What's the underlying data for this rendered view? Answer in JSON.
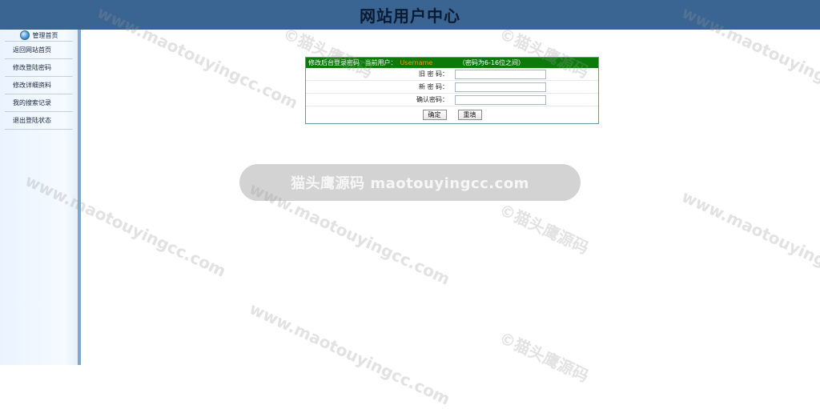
{
  "header": {
    "title": "网站用户中心"
  },
  "sidebar": {
    "heading": "管理首页",
    "items": [
      {
        "label": "返回网站首页"
      },
      {
        "label": "修改登陆密码"
      },
      {
        "label": "修改详细资料"
      },
      {
        "label": "我的搜索记录"
      },
      {
        "label": "退出登陆状态"
      }
    ]
  },
  "panel": {
    "title": "修改后台登录密码",
    "current_user_label": "当前用户：",
    "current_user": "Username",
    "hint": "（密码为6-16位之间）",
    "fields": {
      "old_password_label": "旧 密 码：",
      "new_password_label": "新 密 码：",
      "confirm_password_label": "确认密码："
    },
    "submit_label": "确定",
    "reset_label": "重填"
  },
  "watermark": {
    "bar_text": "猫头鹰源码 maotouyingcc.com",
    "text_a": "©猫头鹰源码",
    "text_b": "www.maotouyingcc.com"
  }
}
